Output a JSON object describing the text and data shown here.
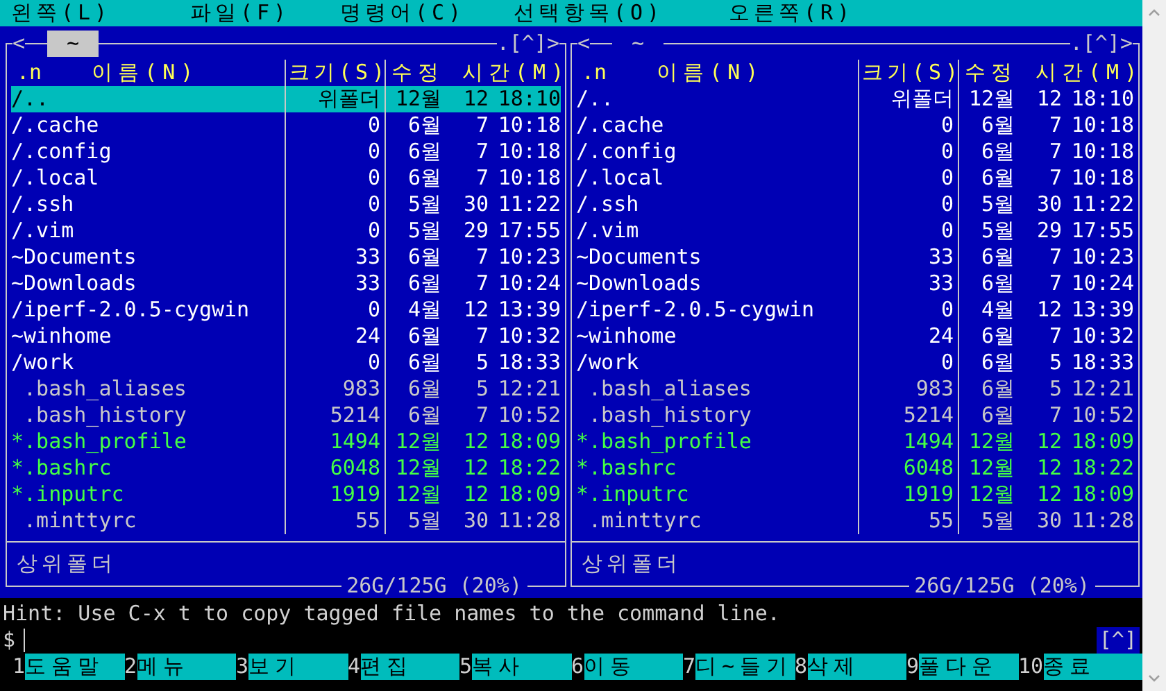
{
  "menu": [
    "왼쪽(L)",
    "파일(F)",
    "명령어(C)",
    "선택항목(O)",
    "오른쪽(R)"
  ],
  "panels": [
    {
      "active": true,
      "left_marker": "<",
      "path": "~",
      "right_marker": ".[^]>",
      "columns": [
        ".n",
        "이름(N)",
        "크기(S)",
        "수정 시간(M)"
      ],
      "rows": [
        {
          "kind": "dir",
          "name": "/..",
          "size": "위폴더",
          "month": "12월",
          "day": "12",
          "time": "18:10",
          "selected": true
        },
        {
          "kind": "dir",
          "name": "/.cache",
          "size": "0",
          "month": "6월",
          "day": "7",
          "time": "10:18",
          "selected": false
        },
        {
          "kind": "dir",
          "name": "/.config",
          "size": "0",
          "month": "6월",
          "day": "7",
          "time": "10:18",
          "selected": false
        },
        {
          "kind": "dir",
          "name": "/.local",
          "size": "0",
          "month": "6월",
          "day": "7",
          "time": "10:18",
          "selected": false
        },
        {
          "kind": "dir",
          "name": "/.ssh",
          "size": "0",
          "month": "5월",
          "day": "30",
          "time": "11:22",
          "selected": false
        },
        {
          "kind": "dir",
          "name": "/.vim",
          "size": "0",
          "month": "5월",
          "day": "29",
          "time": "17:55",
          "selected": false
        },
        {
          "kind": "dir",
          "name": "~Documents",
          "size": "33",
          "month": "6월",
          "day": "7",
          "time": "10:23",
          "selected": false
        },
        {
          "kind": "dir",
          "name": "~Downloads",
          "size": "33",
          "month": "6월",
          "day": "7",
          "time": "10:24",
          "selected": false
        },
        {
          "kind": "dir",
          "name": "/iperf-2.0.5-cygwin",
          "size": "0",
          "month": "4월",
          "day": "12",
          "time": "13:39",
          "selected": false
        },
        {
          "kind": "dir",
          "name": "~winhome",
          "size": "24",
          "month": "6월",
          "day": "7",
          "time": "10:32",
          "selected": false
        },
        {
          "kind": "dir",
          "name": "/work",
          "size": "0",
          "month": "6월",
          "day": "5",
          "time": "18:33",
          "selected": false
        },
        {
          "kind": "file",
          "name": " .bash_aliases",
          "size": "983",
          "month": "6월",
          "day": "5",
          "time": "12:21",
          "selected": false
        },
        {
          "kind": "file",
          "name": " .bash_history",
          "size": "5214",
          "month": "6월",
          "day": "7",
          "time": "10:52",
          "selected": false
        },
        {
          "kind": "exec",
          "name": "*.bash_profile",
          "size": "1494",
          "month": "12월",
          "day": "12",
          "time": "18:09",
          "selected": false
        },
        {
          "kind": "exec",
          "name": "*.bashrc",
          "size": "6048",
          "month": "12월",
          "day": "12",
          "time": "18:22",
          "selected": false
        },
        {
          "kind": "exec",
          "name": "*.inputrc",
          "size": "1919",
          "month": "12월",
          "day": "12",
          "time": "18:09",
          "selected": false
        },
        {
          "kind": "file",
          "name": " .minttyrc",
          "size": "55",
          "month": "5월",
          "day": "30",
          "time": "11:28",
          "selected": false
        }
      ],
      "mini_status": "상위폴더",
      "disk": "26G/125G (20%)"
    },
    {
      "active": false,
      "left_marker": "<",
      "path": "~",
      "right_marker": ".[^]>",
      "columns": [
        ".n",
        "이름(N)",
        "크기(S)",
        "수정 시간(M)"
      ],
      "rows": [
        {
          "kind": "dir",
          "name": "/..",
          "size": "위폴더",
          "month": "12월",
          "day": "12",
          "time": "18:10"
        },
        {
          "kind": "dir",
          "name": "/.cache",
          "size": "0",
          "month": "6월",
          "day": "7",
          "time": "10:18"
        },
        {
          "kind": "dir",
          "name": "/.config",
          "size": "0",
          "month": "6월",
          "day": "7",
          "time": "10:18"
        },
        {
          "kind": "dir",
          "name": "/.local",
          "size": "0",
          "month": "6월",
          "day": "7",
          "time": "10:18"
        },
        {
          "kind": "dir",
          "name": "/.ssh",
          "size": "0",
          "month": "5월",
          "day": "30",
          "time": "11:22"
        },
        {
          "kind": "dir",
          "name": "/.vim",
          "size": "0",
          "month": "5월",
          "day": "29",
          "time": "17:55"
        },
        {
          "kind": "dir",
          "name": "~Documents",
          "size": "33",
          "month": "6월",
          "day": "7",
          "time": "10:23"
        },
        {
          "kind": "dir",
          "name": "~Downloads",
          "size": "33",
          "month": "6월",
          "day": "7",
          "time": "10:24"
        },
        {
          "kind": "dir",
          "name": "/iperf-2.0.5-cygwin",
          "size": "0",
          "month": "4월",
          "day": "12",
          "time": "13:39"
        },
        {
          "kind": "dir",
          "name": "~winhome",
          "size": "24",
          "month": "6월",
          "day": "7",
          "time": "10:32"
        },
        {
          "kind": "dir",
          "name": "/work",
          "size": "0",
          "month": "6월",
          "day": "5",
          "time": "18:33"
        },
        {
          "kind": "file",
          "name": " .bash_aliases",
          "size": "983",
          "month": "6월",
          "day": "5",
          "time": "12:21"
        },
        {
          "kind": "file",
          "name": " .bash_history",
          "size": "5214",
          "month": "6월",
          "day": "7",
          "time": "10:52"
        },
        {
          "kind": "exec",
          "name": "*.bash_profile",
          "size": "1494",
          "month": "12월",
          "day": "12",
          "time": "18:09"
        },
        {
          "kind": "exec",
          "name": "*.bashrc",
          "size": "6048",
          "month": "12월",
          "day": "12",
          "time": "18:22"
        },
        {
          "kind": "exec",
          "name": "*.inputrc",
          "size": "1919",
          "month": "12월",
          "day": "12",
          "time": "18:09"
        },
        {
          "kind": "file",
          "name": " .minttyrc",
          "size": "55",
          "month": "5월",
          "day": "30",
          "time": "11:28"
        }
      ],
      "mini_status": "상위폴더",
      "disk": "26G/125G (20%)"
    }
  ],
  "hint": "Hint: Use C-x t to copy tagged file names to the command line.",
  "prompt": "$",
  "scroll_marker": "[^]",
  "fkeys": [
    {
      "num": "1",
      "label": "도움말"
    },
    {
      "num": "2",
      "label": "메뉴"
    },
    {
      "num": "3",
      "label": "보기"
    },
    {
      "num": "4",
      "label": "편집"
    },
    {
      "num": "5",
      "label": "복사"
    },
    {
      "num": "6",
      "label": "이동"
    },
    {
      "num": "7",
      "label": "디~들기"
    },
    {
      "num": "8",
      "label": "삭제"
    },
    {
      "num": "9",
      "label": "풀다운"
    },
    {
      "num": "10",
      "label": "종료"
    }
  ]
}
